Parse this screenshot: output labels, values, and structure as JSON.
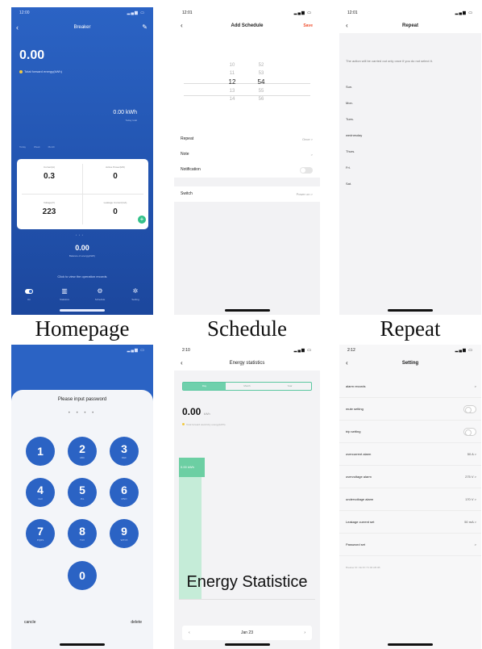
{
  "homepage": {
    "time": "12:00",
    "title": "Breaker",
    "main_value": "0.00",
    "main_label": "Total forward energy(kWh)",
    "kwh_value": "0.00 kWh",
    "kwh_sub": "Today total",
    "mini_tabs": [
      "Today",
      "Week",
      "Month"
    ],
    "cells": [
      {
        "label": "Current(A)",
        "value": "0.3"
      },
      {
        "label": "Active Power(kW)",
        "value": "0"
      },
      {
        "label": "Voltage(V)",
        "value": "223"
      },
      {
        "label": "Leakage Current(mA)",
        "value": "0"
      }
    ],
    "balance_value": "0.00",
    "balance_label": "Balance of energy(kWh)",
    "operation_link": "Click to view the operation records",
    "nav": [
      {
        "icon": "switch-icon",
        "label": "On"
      },
      {
        "icon": "statistics-icon",
        "label": "Statistics"
      },
      {
        "icon": "schedule-icon",
        "label": "Schedule"
      },
      {
        "icon": "setting-icon",
        "label": "Setting"
      }
    ]
  },
  "schedule": {
    "time": "12:01",
    "title": "Add Schedule",
    "save": "Save",
    "hours": [
      "10",
      "11",
      "12",
      "13",
      "14"
    ],
    "minutes": [
      "52",
      "53",
      "54",
      "55",
      "56"
    ],
    "rows": [
      {
        "label": "Repeat",
        "value": "Once >"
      },
      {
        "label": "Note",
        "value": ">"
      },
      {
        "label": "Notification",
        "value": ""
      },
      {
        "label": "Switch",
        "value": "Power on >"
      }
    ]
  },
  "repeat": {
    "time": "12:01",
    "title": "Repeat",
    "note": "The action will be carried out only once if you do not select it.",
    "days": [
      "Sun.",
      "Mon.",
      "Tues.",
      "wednesday",
      "Thurs.",
      "Fri.",
      "Sat."
    ]
  },
  "password": {
    "title": "Please input password",
    "dots": "• • • •",
    "keys": [
      {
        "num": "1",
        "sub": ""
      },
      {
        "num": "2",
        "sub": "ABC"
      },
      {
        "num": "3",
        "sub": "DEF"
      },
      {
        "num": "4",
        "sub": "GHI"
      },
      {
        "num": "5",
        "sub": "JKL"
      },
      {
        "num": "6",
        "sub": "MNO"
      },
      {
        "num": "7",
        "sub": "PQRS"
      },
      {
        "num": "8",
        "sub": "TUV"
      },
      {
        "num": "9",
        "sub": "WXYZ"
      },
      {
        "num": "0",
        "sub": ""
      }
    ],
    "cancel": "cancle",
    "delete": "delete"
  },
  "energy": {
    "time": "2:10",
    "title": "Energy statistics",
    "tabs": [
      "Day",
      "Month",
      "Year"
    ],
    "value": "0.00",
    "unit": "kWh",
    "note": "Total forward electricity energy(kWh)",
    "tip": "0.00 kWh",
    "caption": "Energy  Statistice",
    "date": "Jan 23"
  },
  "setting": {
    "time": "2:12",
    "title": "Setting",
    "rows": [
      {
        "label": "alarm records",
        "value": ">",
        "toggle": false
      },
      {
        "label": "mute setting",
        "value": "",
        "toggle": true
      },
      {
        "label": "trip setting",
        "value": "",
        "toggle": true
      },
      {
        "label": "overcurrent alarm",
        "value": "50 A >",
        "toggle": false
      },
      {
        "label": "overvoltage alarm",
        "value": "275 V >",
        "toggle": false
      },
      {
        "label": "undervoltage alarm",
        "value": "170 V >",
        "toggle": false
      },
      {
        "label": "Leakage current set",
        "value": "50 mA >",
        "toggle": false
      },
      {
        "label": "Password set",
        "value": ">",
        "toggle": false
      }
    ],
    "footer": "Breaker ID: FE FF:7C:00:AB:4B"
  },
  "captions": {
    "homepage": "Homepage",
    "schedule": "Schedule",
    "repeat": "Repeat"
  }
}
